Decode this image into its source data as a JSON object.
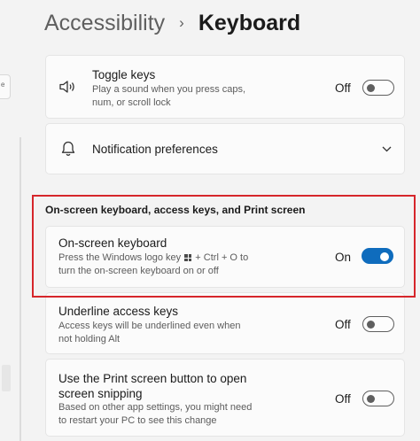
{
  "header": {
    "parent": "Accessibility",
    "separator": "›",
    "current": "Keyboard"
  },
  "edge_tab_text": "e",
  "toggle_keys": {
    "title": "Toggle keys",
    "desc_line1": "Play a sound when you press caps,",
    "desc_line2": "num, or scroll lock",
    "state_label": "Off",
    "on": false
  },
  "notification": {
    "title": "Notification preferences"
  },
  "section_title": "On-screen keyboard, access keys, and Print screen",
  "osk": {
    "title": "On-screen keyboard",
    "desc_line1_pre": "Press the Windows logo key",
    "desc_line1_post": "+ Ctrl + O to",
    "desc_line2": "turn the on-screen keyboard on or off",
    "state_label": "On",
    "on": true
  },
  "underline": {
    "title": "Underline access keys",
    "desc_line1": "Access keys will be underlined even when",
    "desc_line2": "not holding Alt",
    "state_label": "Off",
    "on": false
  },
  "print_screen": {
    "title_line1": "Use the Print screen button to open",
    "title_line2": "screen snipping",
    "desc_line1": "Based on other app settings, you might need",
    "desc_line2": "to restart your PC to see this change",
    "state_label": "Off",
    "on": false
  },
  "colors": {
    "accent": "#0f6cbd",
    "highlight": "#d6262b"
  }
}
